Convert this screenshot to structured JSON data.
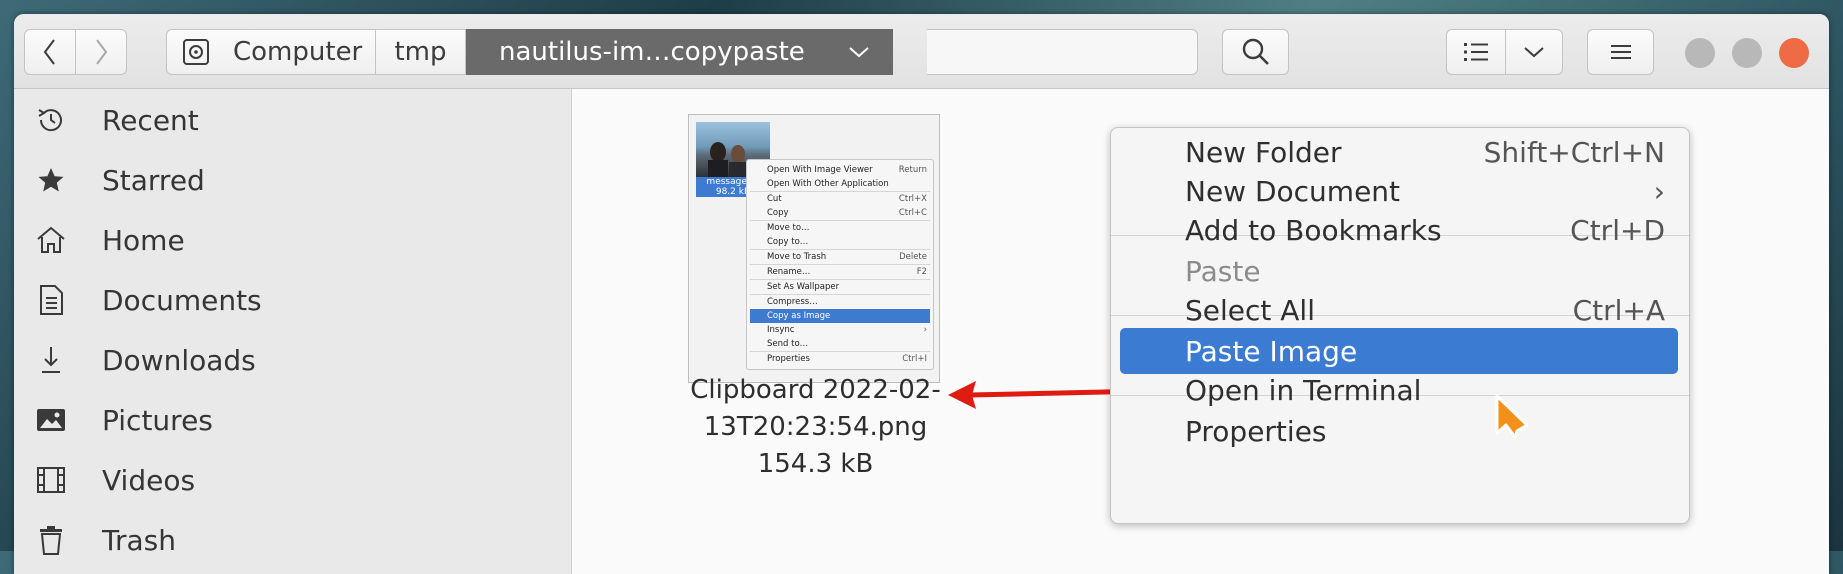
{
  "window": {
    "controls": {
      "minimize_color": "#b8b8b8",
      "maximize_color": "#b8b8b8",
      "close_color": "#ee6b46"
    }
  },
  "toolbar": {
    "back_icon": "chevron-left-icon",
    "forward_icon": "chevron-right-icon",
    "search_icon": "search-icon",
    "view_icon": "list-view-icon",
    "view_dropdown_icon": "chevron-down-icon",
    "menu_icon": "hamburger-menu-icon"
  },
  "pathbar": {
    "crumbs": [
      {
        "label": "Computer",
        "icon": "drive-icon"
      },
      {
        "label": "tmp"
      },
      {
        "label": "nautilus-im…copypaste",
        "active": true
      }
    ]
  },
  "sidebar": {
    "items": [
      {
        "label": "Recent",
        "icon": "clock-icon"
      },
      {
        "label": "Starred",
        "icon": "star-icon"
      },
      {
        "label": "Home",
        "icon": "home-icon"
      },
      {
        "label": "Documents",
        "icon": "document-icon"
      },
      {
        "label": "Downloads",
        "icon": "download-icon"
      },
      {
        "label": "Pictures",
        "icon": "picture-icon"
      },
      {
        "label": "Videos",
        "icon": "film-icon"
      },
      {
        "label": "Trash",
        "icon": "trash-icon"
      }
    ]
  },
  "file": {
    "name_line1": "Clipboard 2022-02-",
    "name_line2": "13T20:23:54.png",
    "size": "154.3 kB",
    "thumbnail": {
      "mini_file_label": "messages_(",
      "mini_file_size": "98.2 kB",
      "mini_menu": [
        {
          "label": "Open With Image Viewer",
          "shortcut": "Return"
        },
        {
          "label": "Open With Other Application",
          "shortcut": "",
          "sep_after": true
        },
        {
          "label": "Cut",
          "shortcut": "Ctrl+X"
        },
        {
          "label": "Copy",
          "shortcut": "Ctrl+C",
          "sep_after": true
        },
        {
          "label": "Move to…",
          "shortcut": ""
        },
        {
          "label": "Copy to…",
          "shortcut": "",
          "sep_after": true
        },
        {
          "label": "Move to Trash",
          "shortcut": "Delete",
          "sep_after": true
        },
        {
          "label": "Rename…",
          "shortcut": "F2",
          "sep_after": true
        },
        {
          "label": "Set As Wallpaper",
          "shortcut": "",
          "sep_after": true
        },
        {
          "label": "Compress…",
          "shortcut": ""
        },
        {
          "label": "Copy as Image",
          "shortcut": "",
          "highlighted": true
        },
        {
          "label": "Insync",
          "shortcut": "›"
        },
        {
          "label": "Send to…",
          "shortcut": "",
          "sep_after": true
        },
        {
          "label": "Properties",
          "shortcut": "Ctrl+I"
        }
      ]
    }
  },
  "annotation": {
    "arrow_color": "#e01b12",
    "cursor_color": "#f39019"
  },
  "context_menu": {
    "items": [
      {
        "label": "New Folder",
        "shortcut": "Shift+Ctrl+N"
      },
      {
        "label": "New Document",
        "shortcut": "›"
      },
      {
        "label": "Add to Bookmarks",
        "shortcut": "Ctrl+D"
      },
      {
        "label": "Paste",
        "shortcut": "",
        "disabled": true
      },
      {
        "label": "Select All",
        "shortcut": "Ctrl+A"
      },
      {
        "label": "Paste Image",
        "shortcut": "",
        "highlighted": true
      },
      {
        "label": "Open in Terminal",
        "shortcut": ""
      },
      {
        "label": "Properties",
        "shortcut": ""
      }
    ],
    "accent": "#3b7bd2"
  }
}
